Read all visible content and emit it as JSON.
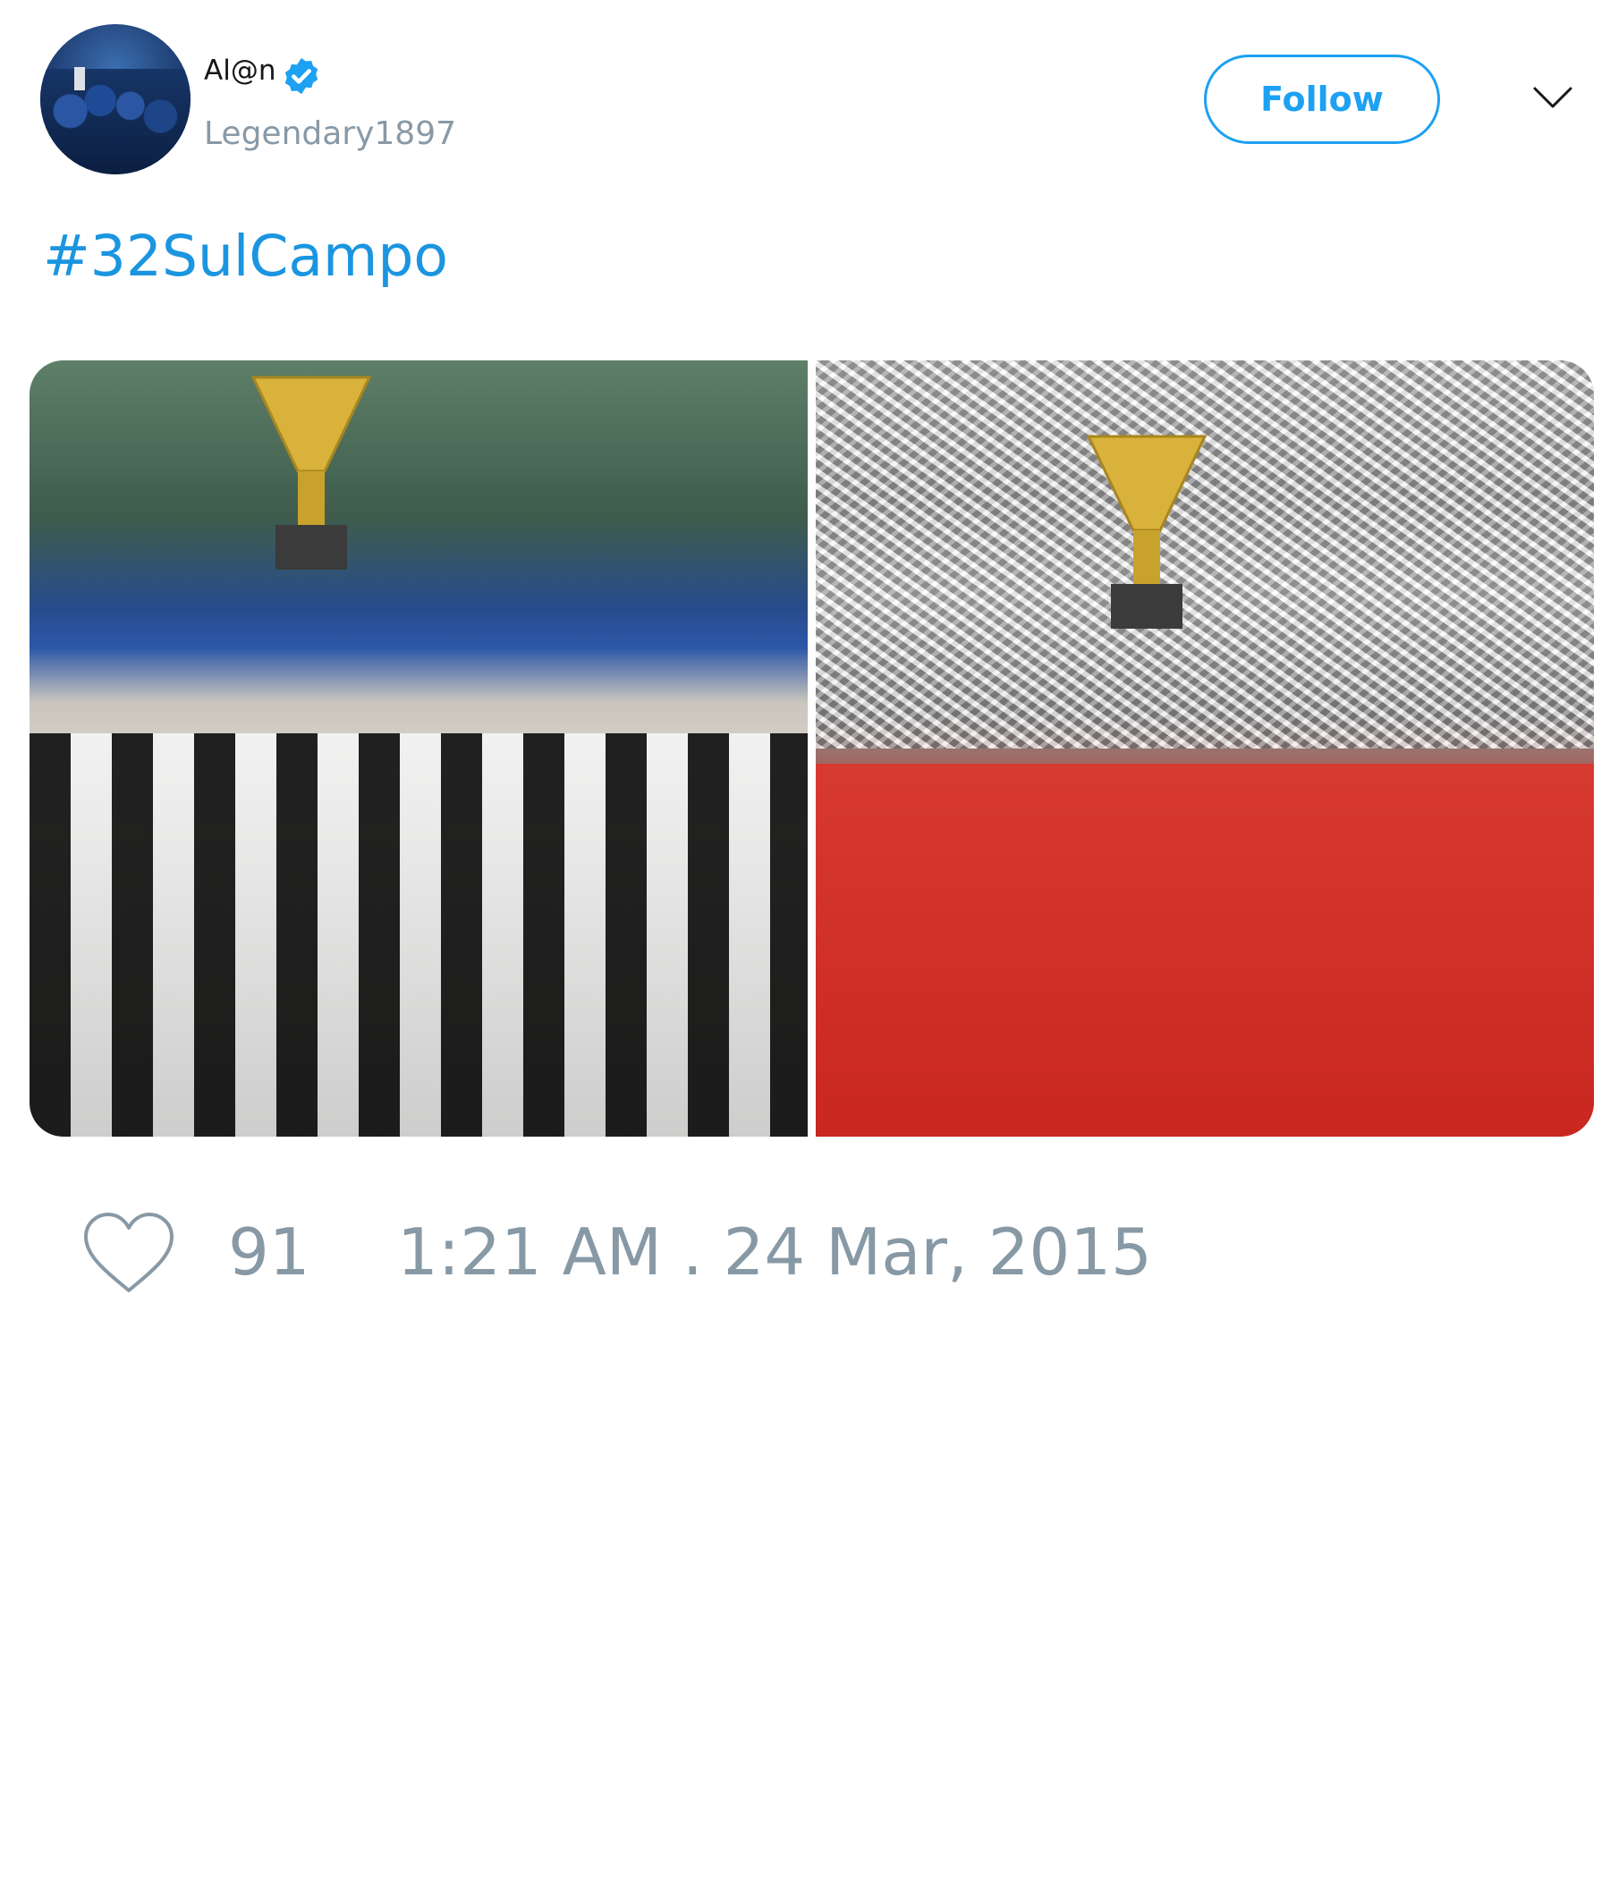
{
  "user": {
    "display_name": "Al@n",
    "username": "Legendary1897",
    "verified": true
  },
  "actions": {
    "follow_label": "Follow"
  },
  "tweet": {
    "text": "#32SulCampo",
    "like_count": "91",
    "timestamp": "1:21 AM . 24 Mar, 2015"
  },
  "icons": {
    "verified": "verified-badge-icon",
    "menu": "chevron-down-icon",
    "like": "heart-icon"
  },
  "colors": {
    "accent": "#1da1f2",
    "hashtag": "#1b95e0",
    "muted": "#8899a6",
    "text": "#14171a"
  }
}
